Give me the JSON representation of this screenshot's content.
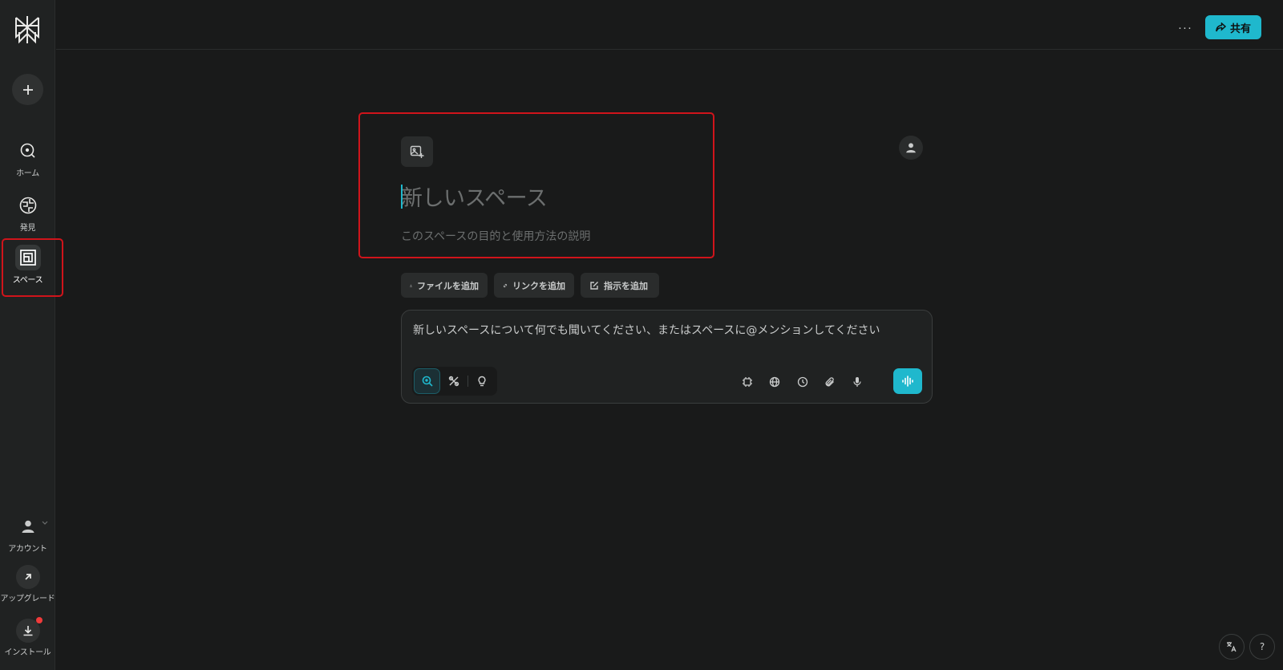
{
  "sidebar": {
    "items": [
      {
        "label": "ホーム",
        "icon": "home-search-icon"
      },
      {
        "label": "発見",
        "icon": "globe-icon"
      },
      {
        "label": "スペース",
        "icon": "spaces-icon"
      },
      {
        "label": "アカウント",
        "icon": "user-icon"
      },
      {
        "label": "アップグレード",
        "icon": "arrow-up-right-icon"
      },
      {
        "label": "インストール",
        "icon": "download-icon"
      }
    ]
  },
  "topbar": {
    "more_label": "···",
    "share_label": "共有"
  },
  "space": {
    "title_placeholder": "新しいスペース",
    "description_placeholder": "このスペースの目的と使用方法の説明"
  },
  "actions": {
    "add_file": "ファイルを追加",
    "add_link": "リンクを追加",
    "add_instructions": "指示を追加"
  },
  "query": {
    "placeholder": "新しいスペースについて何でも聞いてください、またはスペースに@メンションしてください"
  },
  "corner": {
    "help_label": "?"
  },
  "colors": {
    "accent": "#1fb8cd",
    "highlight": "#d0141b",
    "background": "#191a1a"
  }
}
